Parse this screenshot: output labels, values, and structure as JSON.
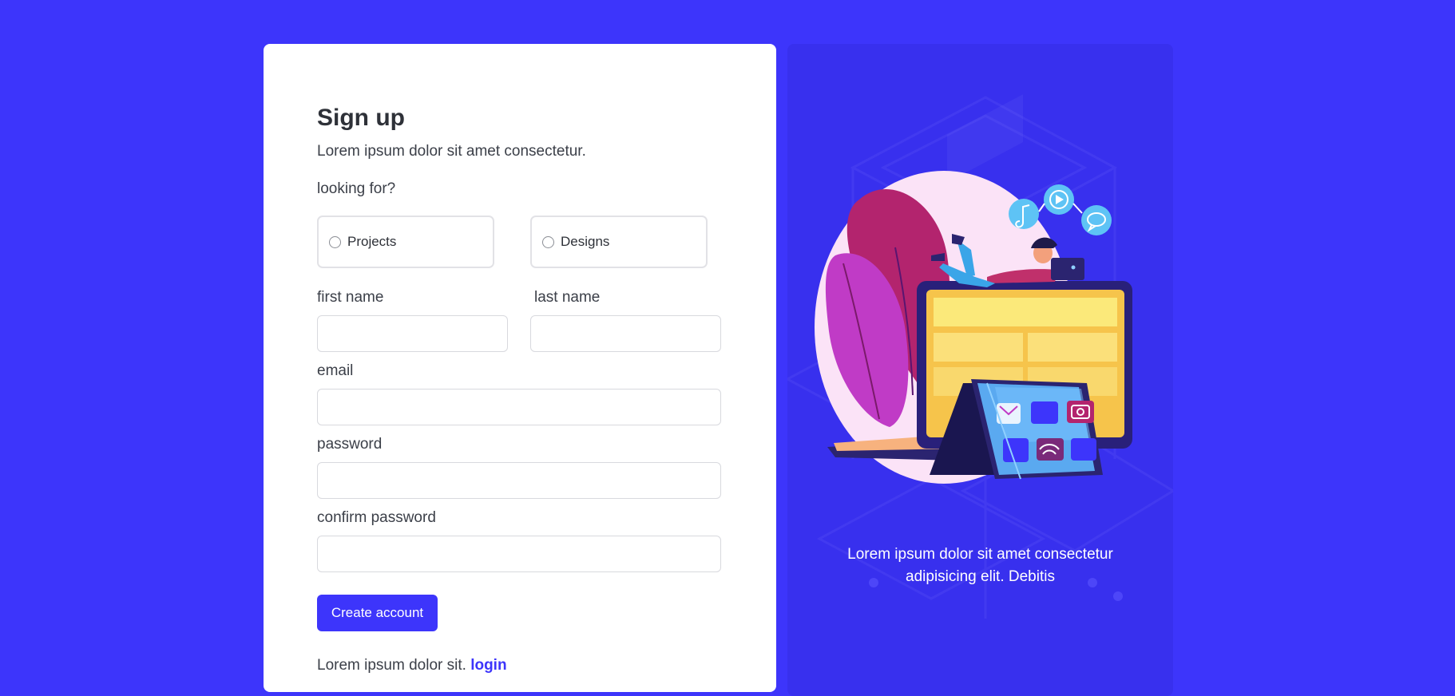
{
  "form": {
    "title": "Sign up",
    "subtitle": "Lorem ipsum dolor sit amet consectetur.",
    "looking_for_label": "looking for?",
    "options": [
      "Projects",
      "Designs"
    ],
    "first_name_label": "first name",
    "last_name_label": "last name",
    "email_label": "email",
    "password_label": "password",
    "confirm_password_label": "confirm password",
    "first_name_value": "",
    "last_name_value": "",
    "email_value": "",
    "password_value": "",
    "confirm_password_value": "",
    "submit_label": "Create account",
    "footer_text": "Lorem ipsum dolor sit.",
    "login_link": "login"
  },
  "illustration": {
    "caption_line1": "Lorem ipsum dolor sit amet consectetur",
    "caption_line2": "adipisicing elit. Debitis"
  },
  "colors": {
    "accent": "#3d35fb",
    "panel": "#3830ee"
  }
}
